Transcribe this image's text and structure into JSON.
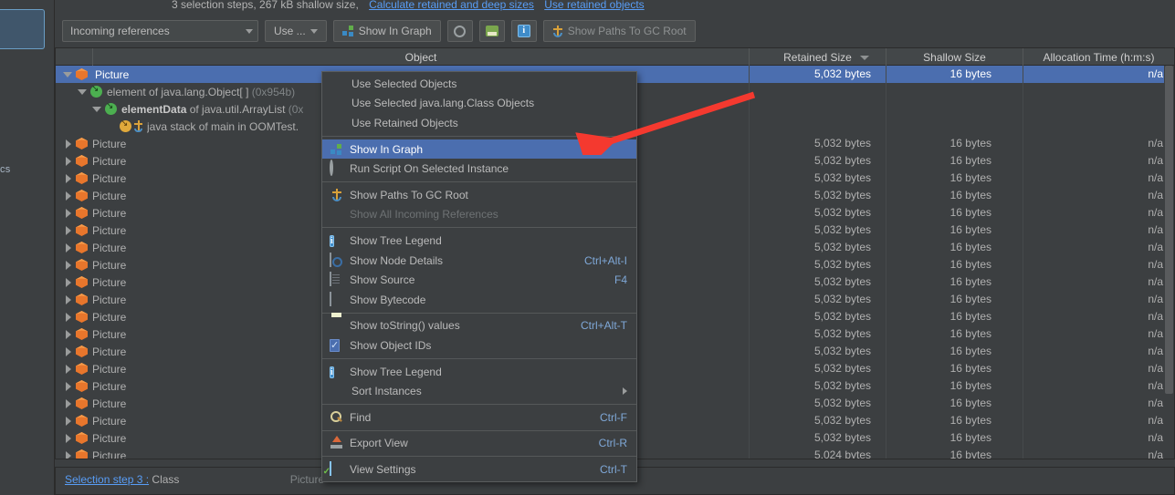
{
  "statusbar": {
    "text": "3 selection steps, 267 kB shallow size,",
    "link_calculate": "Calculate retained and deep sizes",
    "link_use_retained": "Use retained objects"
  },
  "rail": {
    "fragment_text": "cs"
  },
  "toolbar": {
    "view_select_value": "Incoming references",
    "use_button_label": "Use ...",
    "show_in_graph_label": "Show In Graph",
    "show_paths_label": "Show Paths To GC Root",
    "icons": [
      "graph-icon",
      "gear-icon",
      "export-icon",
      "info-icon",
      "anchor-icon"
    ]
  },
  "table": {
    "columns": [
      {
        "label": "",
        "key": "gutter"
      },
      {
        "label": "Object",
        "key": "object"
      },
      {
        "label": "Retained Size",
        "key": "retained",
        "sorted": true
      },
      {
        "label": "Shallow Size",
        "key": "shallow"
      },
      {
        "label": "Allocation Time (h:m:s)",
        "key": "alloc"
      }
    ],
    "rows": [
      {
        "indent": 0,
        "twisty": "open",
        "icon": "cube-icon",
        "label": "Picture",
        "selected": true,
        "retained": "5,032 bytes",
        "shallow": "16 bytes",
        "alloc": "n/a"
      },
      {
        "indent": 1,
        "twisty": "open",
        "icon": "ref-icon",
        "label": "element of java.lang.Object[ ]",
        "suffix": "(0x954b)",
        "retained": "",
        "shallow": "",
        "alloc": ""
      },
      {
        "indent": 2,
        "twisty": "open",
        "icon": "ref-icon",
        "label_bold": "elementData",
        "label": " of java.util.ArrayList",
        "suffix": "(0x",
        "retained": "",
        "shallow": "",
        "alloc": ""
      },
      {
        "indent": 3,
        "twisty": "none",
        "icon": "gc-root-icon",
        "label": "java stack of main in OOMTest.",
        "retained": "",
        "shallow": "",
        "alloc": ""
      },
      {
        "indent": 0,
        "twisty": "closed",
        "icon": "cube-icon",
        "label": "Picture",
        "retained": "5,032 bytes",
        "shallow": "16 bytes",
        "alloc": "n/a"
      },
      {
        "indent": 0,
        "twisty": "closed",
        "icon": "cube-icon",
        "label": "Picture",
        "retained": "5,032 bytes",
        "shallow": "16 bytes",
        "alloc": "n/a"
      },
      {
        "indent": 0,
        "twisty": "closed",
        "icon": "cube-icon",
        "label": "Picture",
        "retained": "5,032 bytes",
        "shallow": "16 bytes",
        "alloc": "n/a"
      },
      {
        "indent": 0,
        "twisty": "closed",
        "icon": "cube-icon",
        "label": "Picture",
        "retained": "5,032 bytes",
        "shallow": "16 bytes",
        "alloc": "n/a"
      },
      {
        "indent": 0,
        "twisty": "closed",
        "icon": "cube-icon",
        "label": "Picture",
        "retained": "5,032 bytes",
        "shallow": "16 bytes",
        "alloc": "n/a"
      },
      {
        "indent": 0,
        "twisty": "closed",
        "icon": "cube-icon",
        "label": "Picture",
        "retained": "5,032 bytes",
        "shallow": "16 bytes",
        "alloc": "n/a"
      },
      {
        "indent": 0,
        "twisty": "closed",
        "icon": "cube-icon",
        "label": "Picture",
        "retained": "5,032 bytes",
        "shallow": "16 bytes",
        "alloc": "n/a"
      },
      {
        "indent": 0,
        "twisty": "closed",
        "icon": "cube-icon",
        "label": "Picture",
        "retained": "5,032 bytes",
        "shallow": "16 bytes",
        "alloc": "n/a"
      },
      {
        "indent": 0,
        "twisty": "closed",
        "icon": "cube-icon",
        "label": "Picture",
        "retained": "5,032 bytes",
        "shallow": "16 bytes",
        "alloc": "n/a"
      },
      {
        "indent": 0,
        "twisty": "closed",
        "icon": "cube-icon",
        "label": "Picture",
        "retained": "5,032 bytes",
        "shallow": "16 bytes",
        "alloc": "n/a"
      },
      {
        "indent": 0,
        "twisty": "closed",
        "icon": "cube-icon",
        "label": "Picture",
        "retained": "5,032 bytes",
        "shallow": "16 bytes",
        "alloc": "n/a"
      },
      {
        "indent": 0,
        "twisty": "closed",
        "icon": "cube-icon",
        "label": "Picture",
        "retained": "5,032 bytes",
        "shallow": "16 bytes",
        "alloc": "n/a"
      },
      {
        "indent": 0,
        "twisty": "closed",
        "icon": "cube-icon",
        "label": "Picture",
        "retained": "5,032 bytes",
        "shallow": "16 bytes",
        "alloc": "n/a"
      },
      {
        "indent": 0,
        "twisty": "closed",
        "icon": "cube-icon",
        "label": "Picture",
        "retained": "5,032 bytes",
        "shallow": "16 bytes",
        "alloc": "n/a"
      },
      {
        "indent": 0,
        "twisty": "closed",
        "icon": "cube-icon",
        "label": "Picture",
        "retained": "5,032 bytes",
        "shallow": "16 bytes",
        "alloc": "n/a"
      },
      {
        "indent": 0,
        "twisty": "closed",
        "icon": "cube-icon",
        "label": "Picture",
        "retained": "5,032 bytes",
        "shallow": "16 bytes",
        "alloc": "n/a"
      },
      {
        "indent": 0,
        "twisty": "closed",
        "icon": "cube-icon",
        "label": "Picture",
        "retained": "5,032 bytes",
        "shallow": "16 bytes",
        "alloc": "n/a"
      },
      {
        "indent": 0,
        "twisty": "closed",
        "icon": "cube-icon",
        "label": "Picture",
        "retained": "5,032 bytes",
        "shallow": "16 bytes",
        "alloc": "n/a"
      },
      {
        "indent": 0,
        "twisty": "closed",
        "icon": "cube-icon",
        "label": "Picture",
        "retained": "5,024 bytes",
        "shallow": "16 bytes",
        "alloc": "n/a"
      }
    ]
  },
  "context_menu": {
    "groups": [
      {
        "items": [
          {
            "label": "Use Selected Objects",
            "icon": "none",
            "shortcut": ""
          },
          {
            "label": "Use Selected java.lang.Class Objects",
            "icon": "none",
            "shortcut": ""
          },
          {
            "label": "Use Retained Objects",
            "icon": "none",
            "shortcut": ""
          }
        ]
      },
      {
        "items": [
          {
            "label": "Show In Graph",
            "icon": "graph-icon",
            "shortcut": "",
            "selected": true
          },
          {
            "label": "Run Script On Selected Instance",
            "icon": "gear-icon",
            "shortcut": ""
          }
        ]
      },
      {
        "items": [
          {
            "label": "Show Paths To GC Root",
            "icon": "anchor-icon",
            "shortcut": ""
          },
          {
            "label": "Show All Incoming References",
            "icon": "circle-gray-icon",
            "shortcut": "",
            "disabled": true
          }
        ]
      },
      {
        "items": [
          {
            "label": "Show Tree Legend",
            "icon": "info-icon",
            "shortcut": ""
          },
          {
            "label": "Show Node Details",
            "icon": "node-details-icon",
            "shortcut": "Ctrl+Alt-I"
          },
          {
            "label": "Show Source",
            "icon": "source-icon",
            "shortcut": "F4"
          },
          {
            "label": "Show Bytecode",
            "icon": "bytecode-icon",
            "shortcut": ""
          }
        ]
      },
      {
        "items": [
          {
            "label": "Show toString() values",
            "icon": "tostring-icon",
            "shortcut": "Ctrl+Alt-T"
          },
          {
            "label": "Show Object IDs",
            "icon": "checkbox-checked-icon",
            "shortcut": ""
          }
        ]
      },
      {
        "items": [
          {
            "label": "Show Tree Legend",
            "icon": "info-icon",
            "shortcut": ""
          },
          {
            "label": "Sort Instances",
            "icon": "none",
            "shortcut": "",
            "submenu": true
          }
        ]
      },
      {
        "items": [
          {
            "label": "Find",
            "icon": "find-icon",
            "shortcut": "Ctrl-F"
          }
        ]
      },
      {
        "items": [
          {
            "label": "Export View",
            "icon": "export-up-icon",
            "shortcut": "Ctrl-R"
          }
        ]
      },
      {
        "items": [
          {
            "label": "View Settings",
            "icon": "view-settings-icon",
            "shortcut": "Ctrl-T"
          }
        ]
      }
    ]
  },
  "bottom_panel": {
    "link_label": "Selection step 3 :",
    "value": "Class",
    "second_line": "Picture"
  },
  "colors": {
    "background": "#3c3f41",
    "selection": "#4b6eaf",
    "link": "#589df6",
    "annotation_arrow": "#f4392f",
    "cube_icon": "#e8762c"
  }
}
